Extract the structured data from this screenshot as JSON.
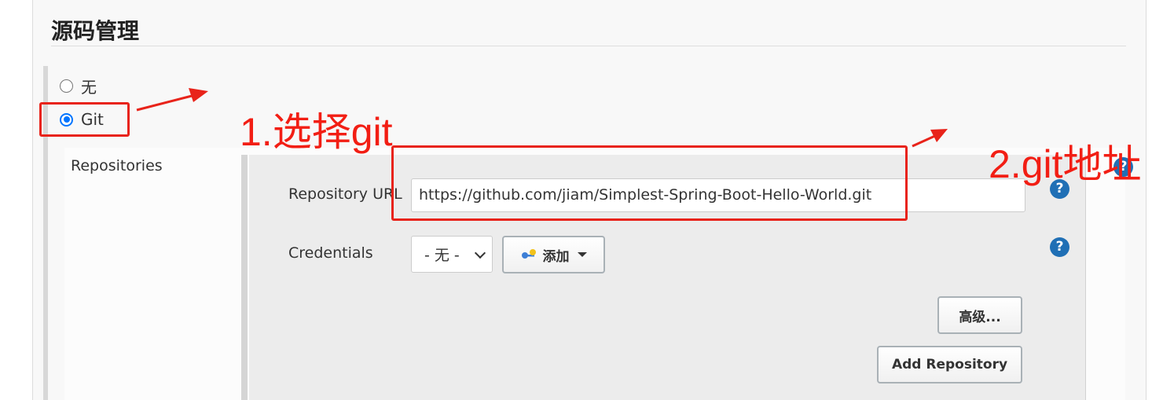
{
  "section": {
    "title": "源码管理"
  },
  "scm": {
    "options": [
      {
        "label": "无",
        "selected": false
      },
      {
        "label": "Git",
        "selected": true
      }
    ]
  },
  "git": {
    "repositories_label": "Repositories",
    "repository_url_label": "Repository URL",
    "repository_url_value": "https://github.com/jiam/Simplest-Spring-Boot-Hello-World.git",
    "credentials_label": "Credentials",
    "credentials_selected": "- 无 -",
    "add_button": "添加",
    "advanced_button": "高级...",
    "add_repository_button": "Add Repository",
    "help_icon_glyph": "?"
  },
  "annotations": {
    "step1": "1.选择git",
    "step2": "2.git地址",
    "color": "#f21e14"
  }
}
